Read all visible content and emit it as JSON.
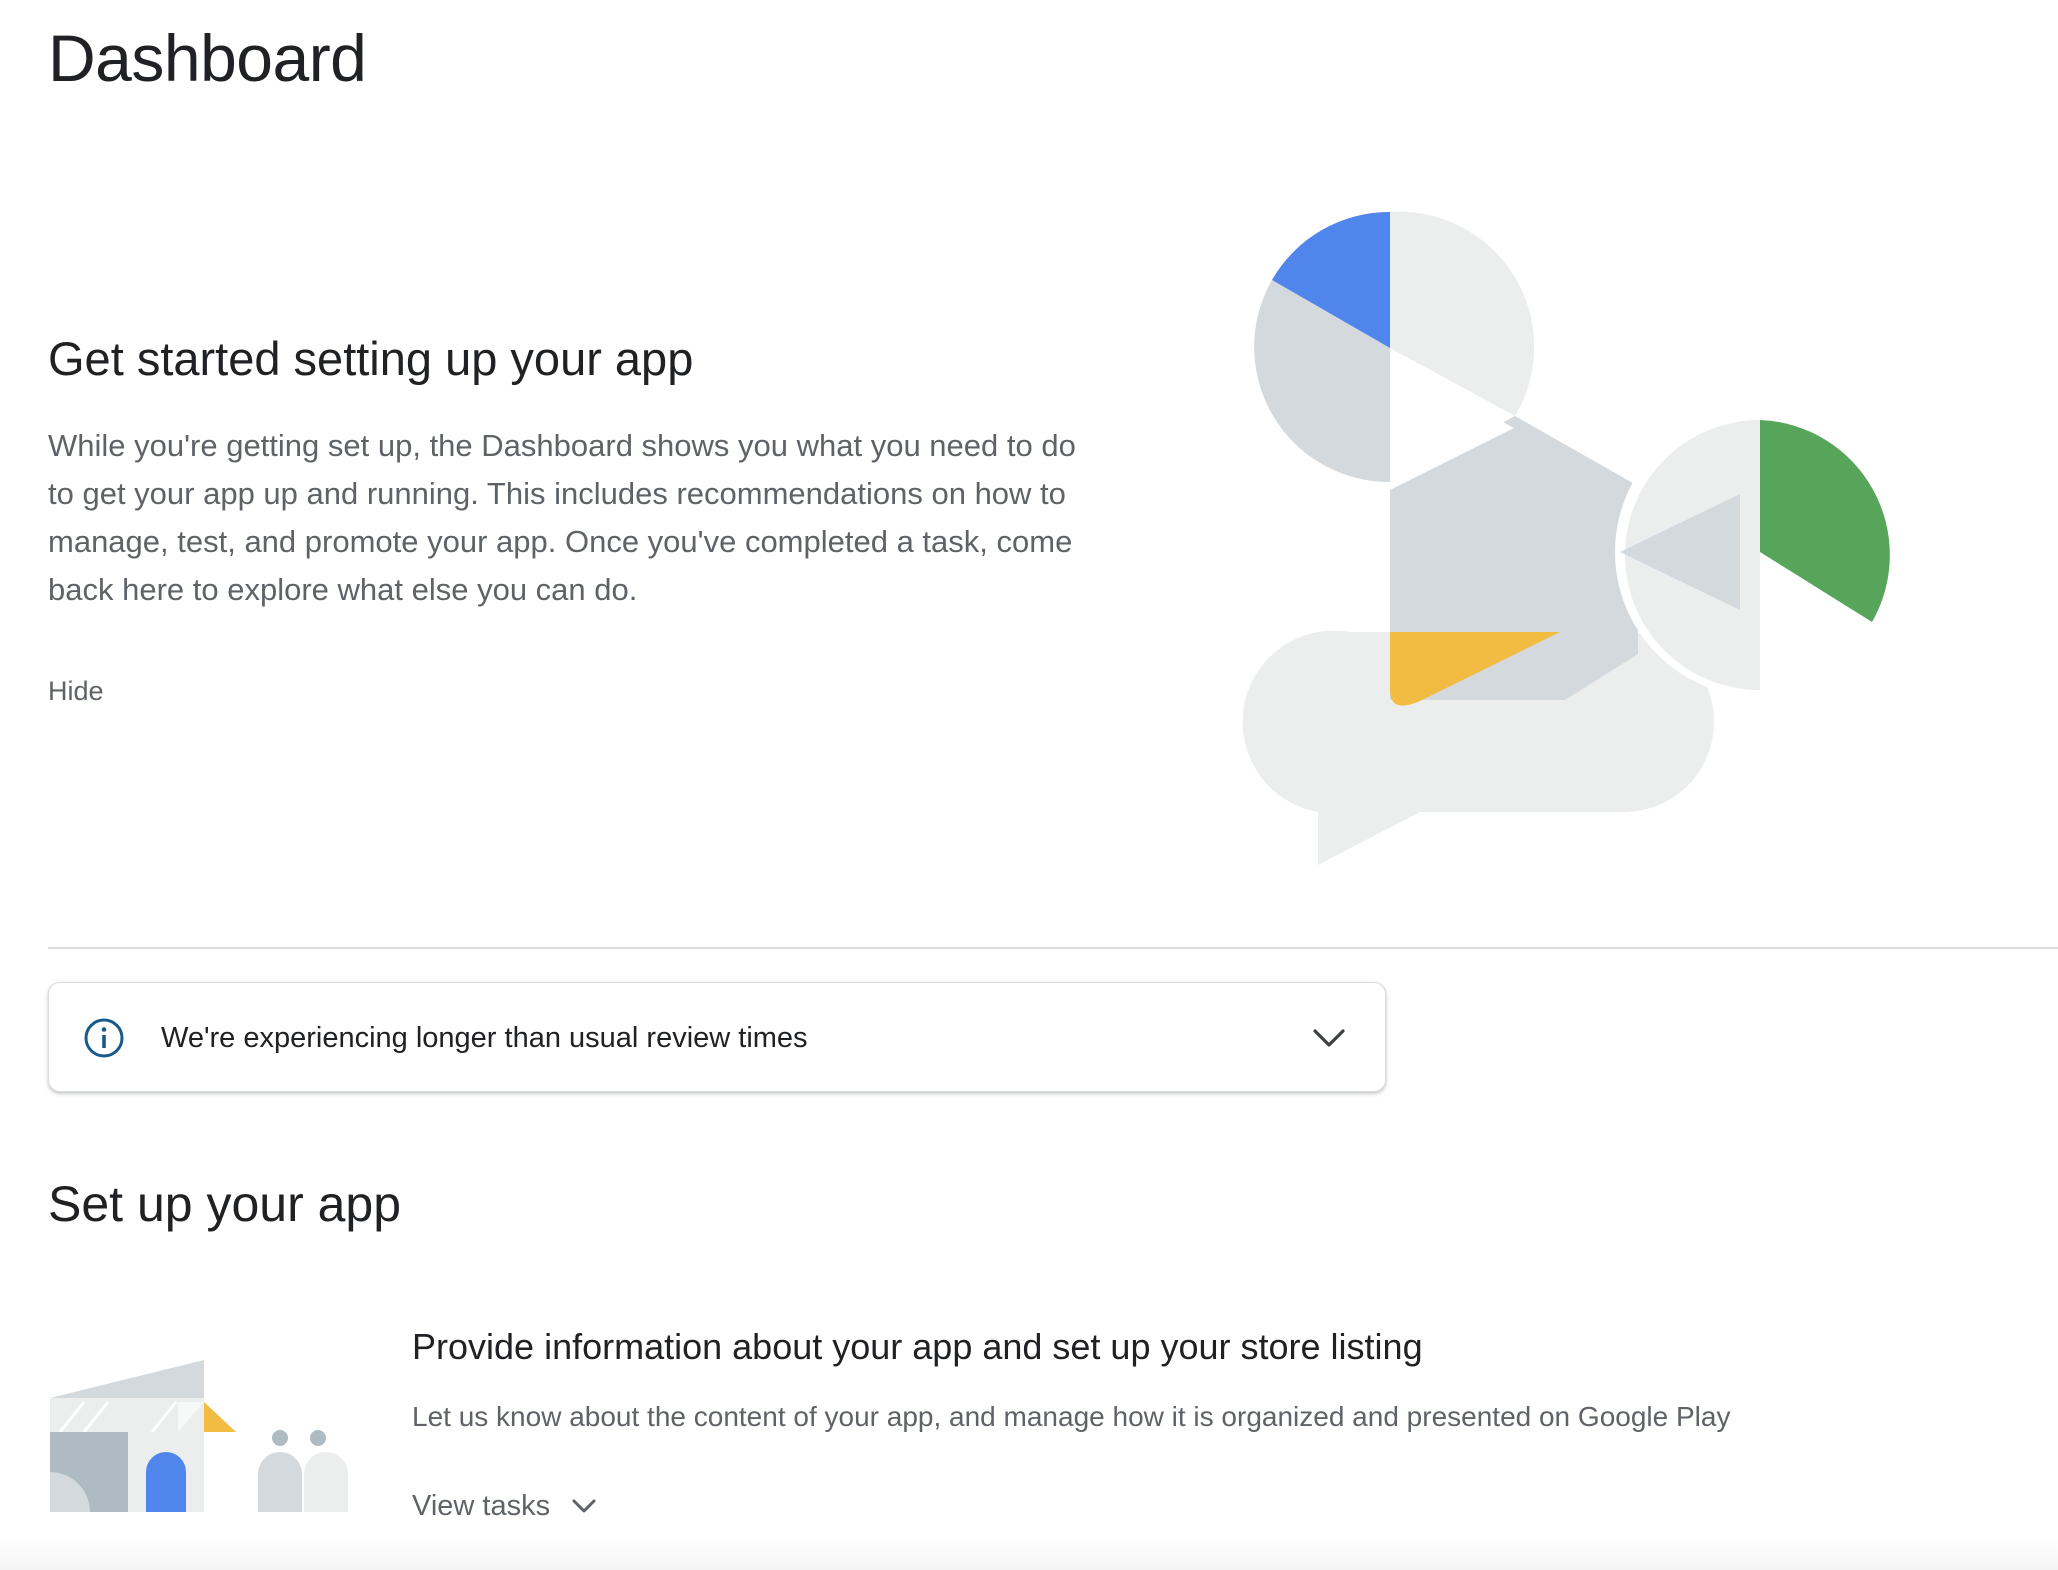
{
  "page": {
    "title": "Dashboard"
  },
  "intro": {
    "heading": "Get started setting up your app",
    "body": "While you're getting set up, the Dashboard shows you what you need to do to get your app up and running. This includes recommendations on how to manage, test, and promote your app. Once you've completed a task, come back here to explore what else you can do.",
    "hide_label": "Hide",
    "illustration": "google-play-shapes-illustration"
  },
  "banner": {
    "icon": "info-icon",
    "text": "We're experiencing longer than usual review times",
    "toggle_icon": "chevron-down-icon"
  },
  "setup": {
    "heading": "Set up your app",
    "task": {
      "illustration": "store-building-illustration",
      "title": "Provide information about your app and set up your store listing",
      "description": "Let us know about the content of your app, and manage how it is organized and presented on Google Play",
      "view_tasks_label": "View tasks",
      "toggle_icon": "chevron-down-icon"
    }
  },
  "colors": {
    "blue": "#5086ec",
    "green": "#57a55a",
    "yellow": "#f2bc42",
    "light_grey": "#eceded",
    "mid_grey": "#d3d9dc",
    "info_icon": "#1a5a8a",
    "text_primary": "#202124",
    "text_secondary": "#5f6368"
  }
}
